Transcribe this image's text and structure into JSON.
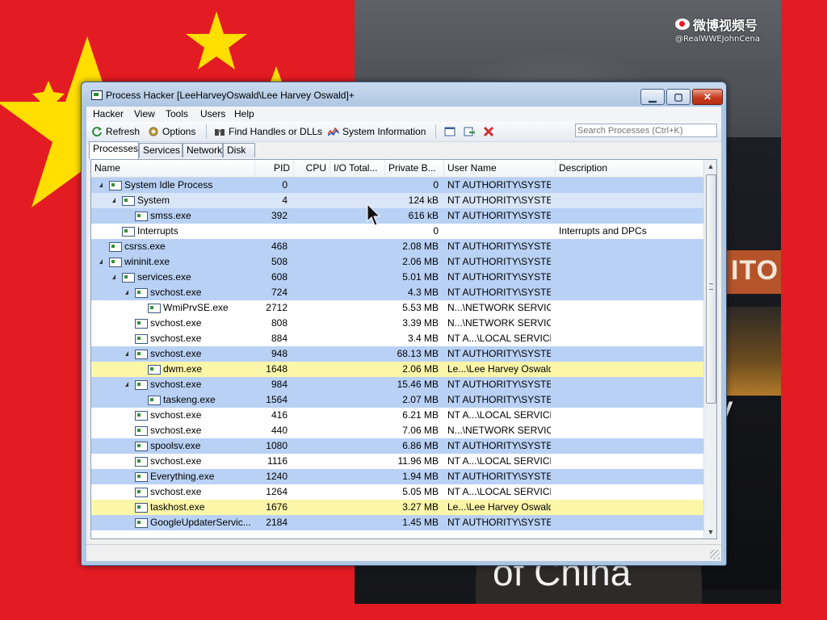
{
  "watermark": {
    "brand": "微博视频号",
    "handle": "@RealWWEJohnCena"
  },
  "video": {
    "sign_text": "ITO",
    "subtitle_line1": "ty",
    "subtitle_line2": "of China"
  },
  "window": {
    "title": "Process Hacker [LeeHarveyOswald\\Lee Harvey Oswald]+",
    "caption_buttons": {
      "minimize": "▁",
      "maximize": "▢",
      "close": "✕"
    }
  },
  "menu": [
    "Hacker",
    "View",
    "Tools",
    "Users",
    "Help"
  ],
  "toolbar": {
    "refresh": "Refresh",
    "options": "Options",
    "find_handles": "Find Handles or DLLs",
    "system_information": "System Information",
    "search_placeholder": "Search Processes (Ctrl+K)"
  },
  "tabs": [
    "Processes",
    "Services",
    "Network",
    "Disk"
  ],
  "columns": [
    "Name",
    "PID",
    "CPU",
    "I/O Total...",
    "Private B...",
    "User Name",
    "Description"
  ],
  "processes": [
    {
      "name": "System Idle Process",
      "level": 0,
      "expand": true,
      "pid": "0",
      "private": "0",
      "user": "NT AUTHORITY\\SYSTEM",
      "desc": "",
      "color": "blue"
    },
    {
      "name": "System",
      "level": 1,
      "expand": true,
      "pid": "4",
      "private": "124 kB",
      "user": "NT AUTHORITY\\SYSTEM",
      "desc": "",
      "color": "lightblue"
    },
    {
      "name": "smss.exe",
      "level": 2,
      "expand": false,
      "pid": "392",
      "private": "616 kB",
      "user": "NT AUTHORITY\\SYSTEM",
      "desc": "",
      "color": "blue"
    },
    {
      "name": "Interrupts",
      "level": 1,
      "expand": false,
      "pid": "",
      "private": "0",
      "user": "",
      "desc": "Interrupts and DPCs",
      "color": "white"
    },
    {
      "name": "csrss.exe",
      "level": 0,
      "expand": false,
      "pid": "468",
      "private": "2.08 MB",
      "user": "NT AUTHORITY\\SYSTEM",
      "desc": "",
      "color": "blue"
    },
    {
      "name": "wininit.exe",
      "level": 0,
      "expand": true,
      "pid": "508",
      "private": "2.06 MB",
      "user": "NT AUTHORITY\\SYSTEM",
      "desc": "",
      "color": "blue"
    },
    {
      "name": "services.exe",
      "level": 1,
      "expand": true,
      "pid": "608",
      "private": "5.01 MB",
      "user": "NT AUTHORITY\\SYSTEM",
      "desc": "",
      "color": "blue"
    },
    {
      "name": "svchost.exe",
      "level": 2,
      "expand": true,
      "pid": "724",
      "private": "4.3 MB",
      "user": "NT AUTHORITY\\SYSTEM",
      "desc": "",
      "color": "blue"
    },
    {
      "name": "WmiPrvSE.exe",
      "level": 3,
      "expand": false,
      "pid": "2712",
      "private": "5.53 MB",
      "user": "N...\\NETWORK SERVICE",
      "desc": "",
      "color": "white"
    },
    {
      "name": "svchost.exe",
      "level": 2,
      "expand": false,
      "pid": "808",
      "private": "3.39 MB",
      "user": "N...\\NETWORK SERVICE",
      "desc": "",
      "color": "white"
    },
    {
      "name": "svchost.exe",
      "level": 2,
      "expand": false,
      "pid": "884",
      "private": "3.4 MB",
      "user": "NT A...\\LOCAL SERVICE",
      "desc": "",
      "color": "white"
    },
    {
      "name": "svchost.exe",
      "level": 2,
      "expand": true,
      "pid": "948",
      "private": "68.13 MB",
      "user": "NT AUTHORITY\\SYSTEM",
      "desc": "",
      "color": "blue"
    },
    {
      "name": "dwm.exe",
      "level": 3,
      "expand": false,
      "pid": "1648",
      "private": "2.06 MB",
      "user": "Le...\\Lee Harvey Oswald",
      "desc": "",
      "color": "yellow"
    },
    {
      "name": "svchost.exe",
      "level": 2,
      "expand": true,
      "pid": "984",
      "private": "15.46 MB",
      "user": "NT AUTHORITY\\SYSTEM",
      "desc": "",
      "color": "blue"
    },
    {
      "name": "taskeng.exe",
      "level": 3,
      "expand": false,
      "pid": "1564",
      "private": "2.07 MB",
      "user": "NT AUTHORITY\\SYSTEM",
      "desc": "",
      "color": "blue"
    },
    {
      "name": "svchost.exe",
      "level": 2,
      "expand": false,
      "pid": "416",
      "private": "6.21 MB",
      "user": "NT A...\\LOCAL SERVICE",
      "desc": "",
      "color": "white"
    },
    {
      "name": "svchost.exe",
      "level": 2,
      "expand": false,
      "pid": "440",
      "private": "7.06 MB",
      "user": "N...\\NETWORK SERVICE",
      "desc": "",
      "color": "white"
    },
    {
      "name": "spoolsv.exe",
      "level": 2,
      "expand": false,
      "pid": "1080",
      "private": "6.86 MB",
      "user": "NT AUTHORITY\\SYSTEM",
      "desc": "",
      "color": "blue"
    },
    {
      "name": "svchost.exe",
      "level": 2,
      "expand": false,
      "pid": "1116",
      "private": "11.96 MB",
      "user": "NT A...\\LOCAL SERVICE",
      "desc": "",
      "color": "white"
    },
    {
      "name": "Everything.exe",
      "level": 2,
      "expand": false,
      "pid": "1240",
      "private": "1.94 MB",
      "user": "NT AUTHORITY\\SYSTEM",
      "desc": "",
      "color": "blue"
    },
    {
      "name": "svchost.exe",
      "level": 2,
      "expand": false,
      "pid": "1264",
      "private": "5.05 MB",
      "user": "NT A...\\LOCAL SERVICE",
      "desc": "",
      "color": "white"
    },
    {
      "name": "taskhost.exe",
      "level": 2,
      "expand": false,
      "pid": "1676",
      "private": "3.27 MB",
      "user": "Le...\\Lee Harvey Oswald",
      "desc": "",
      "color": "yellow"
    },
    {
      "name": "GoogleUpdaterServic...",
      "level": 2,
      "expand": false,
      "pid": "2184",
      "private": "1.45 MB",
      "user": "NT AUTHORITY\\SYSTEM",
      "desc": "",
      "color": "blue"
    }
  ],
  "colors": {
    "service_row": "#b9d1f5",
    "user_row": "#fbf6a8",
    "flag_red": "#e31b23",
    "flag_star": "#ffde00"
  }
}
